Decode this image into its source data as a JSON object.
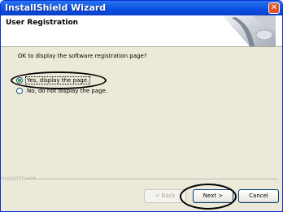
{
  "window": {
    "title": "InstallShield Wizard",
    "close_glyph": "✕"
  },
  "header": {
    "title": "User Registration",
    "logo_icon": "computer-disk-icon"
  },
  "body": {
    "prompt": "OK to display the software registration page?",
    "options": [
      {
        "label": "Yes, display the page.",
        "selected": true
      },
      {
        "label": "No, do not display the page.",
        "selected": false
      }
    ]
  },
  "footer": {
    "brand": "InstallShield",
    "back_label": "< Back",
    "next_label": "Next >",
    "cancel_label": "Cancel"
  },
  "colors": {
    "titlebar": "#0a4ee0",
    "dialog_bg": "#ece9d8",
    "close_button": "#e0552d",
    "radio_dot": "#21a121"
  }
}
